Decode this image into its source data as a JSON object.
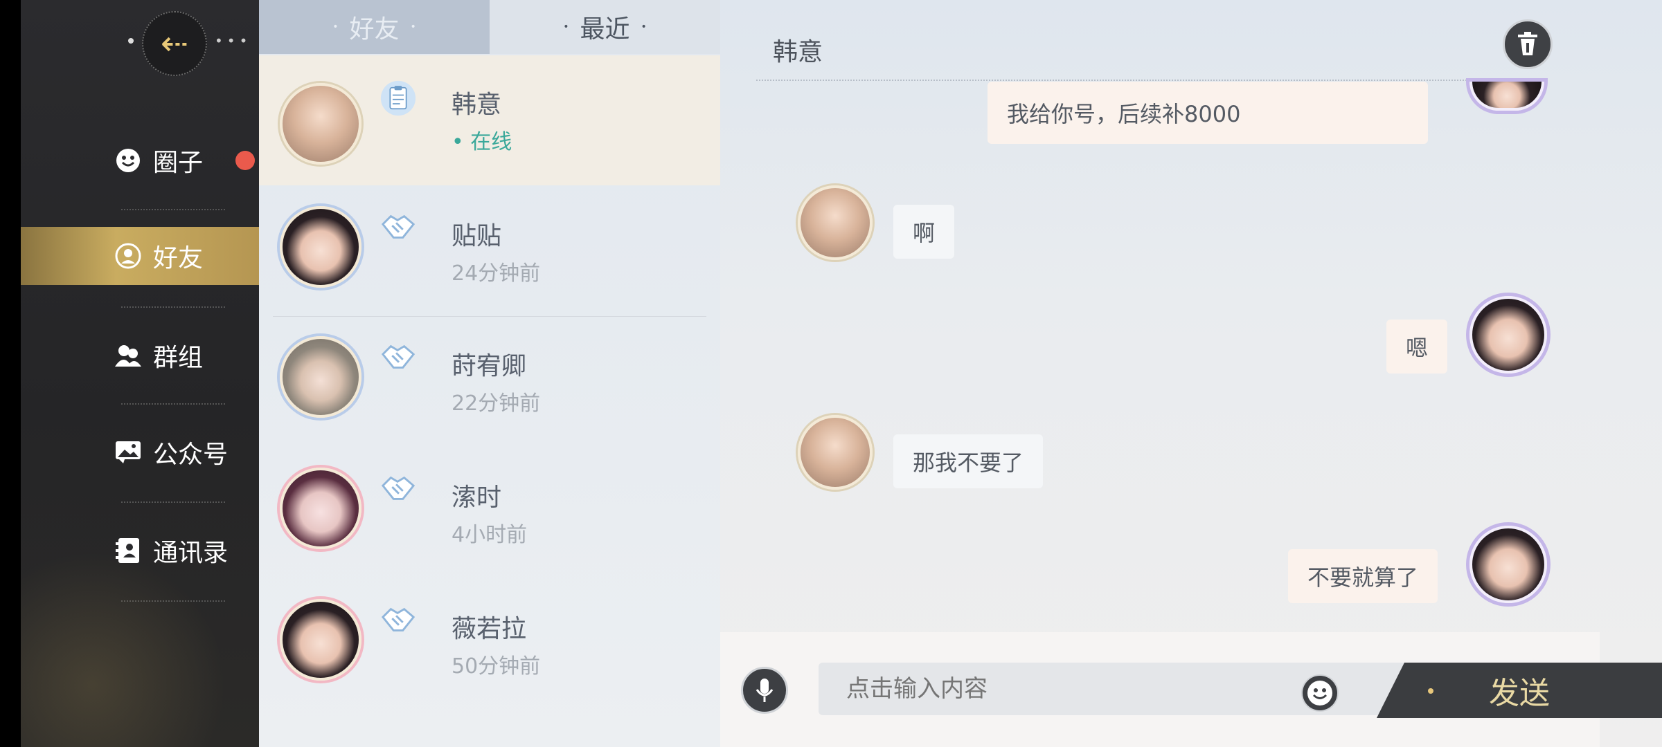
{
  "nav": {
    "items": [
      {
        "label": "圈子",
        "icon": "smiley-icon"
      },
      {
        "label": "好友",
        "icon": "friend-icon"
      },
      {
        "label": "群组",
        "icon": "group-icon"
      },
      {
        "label": "公众号",
        "icon": "image-icon"
      },
      {
        "label": "通讯录",
        "icon": "contacts-icon"
      }
    ],
    "active": "好友",
    "circle_has_notification": true
  },
  "tabs": [
    {
      "label": "好友",
      "active": true
    },
    {
      "label": "最近",
      "active": false
    }
  ],
  "friends": [
    {
      "name": "韩意",
      "status": "在线",
      "online": true,
      "badge": "clipboard-icon"
    },
    {
      "name": "贴贴",
      "status": "24分钟前",
      "online": false,
      "badge": "handshake-icon"
    },
    {
      "name": "莳宥卿",
      "status": "22分钟前",
      "online": false,
      "badge": "handshake-icon"
    },
    {
      "name": "溹时",
      "status": "4小时前",
      "online": false,
      "badge": "handshake-icon"
    },
    {
      "name": "薇若拉",
      "status": "50分钟前",
      "online": false,
      "badge": "handshake-icon"
    }
  ],
  "chat": {
    "title": "韩意",
    "messages": [
      {
        "side": "right",
        "text_partial": "我给你号，后续补8000"
      },
      {
        "side": "left",
        "text": "啊"
      },
      {
        "side": "right",
        "text": "嗯"
      },
      {
        "side": "left",
        "text": "那我不要了"
      },
      {
        "side": "right",
        "text": "不要就算了"
      }
    ],
    "input_placeholder": "点击输入内容",
    "send_label": "发送"
  },
  "colors": {
    "nav_bg": "#2b2b2e",
    "active_gold": "#c9ac60",
    "online_green": "#3aa89a",
    "notification_red": "#ea5a4c"
  }
}
